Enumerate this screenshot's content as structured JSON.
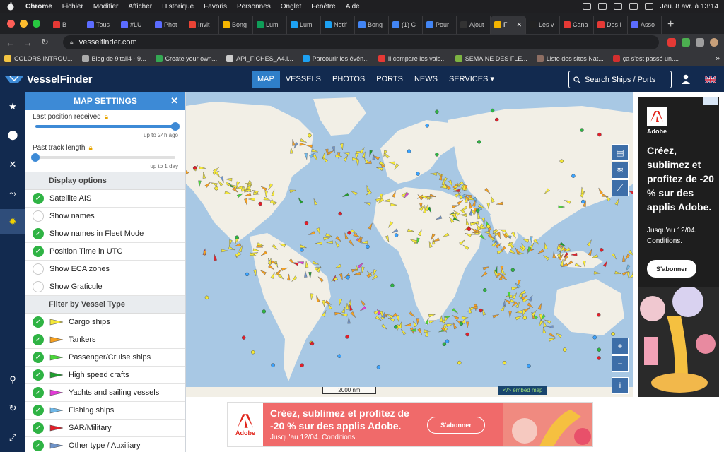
{
  "macos": {
    "app": "Chrome",
    "menus": [
      "Fichier",
      "Modifier",
      "Afficher",
      "Historique",
      "Favoris",
      "Personnes",
      "Onglet",
      "Fenêtre",
      "Aide"
    ],
    "datetime": "Jeu. 8 avr. à 13:14"
  },
  "tabs": [
    {
      "label": "B",
      "color": "#e53935"
    },
    {
      "label": "Tous",
      "color": "#5b6cff"
    },
    {
      "label": "#LU",
      "color": "#5b6cff"
    },
    {
      "label": "Phot",
      "color": "#5b6cff"
    },
    {
      "label": "Invit",
      "color": "#ea4335"
    },
    {
      "label": "Bong",
      "color": "#f4b400"
    },
    {
      "label": "Lumi",
      "color": "#0f9d58"
    },
    {
      "label": "Lumi",
      "color": "#1da1f2"
    },
    {
      "label": "Notif",
      "color": "#1da1f2"
    },
    {
      "label": "Bong",
      "color": "#4285f4"
    },
    {
      "label": "(1) C",
      "color": "#4285f4"
    },
    {
      "label": "Pour",
      "color": "#4285f4"
    },
    {
      "label": "Ajout",
      "color": "#333333"
    },
    {
      "label": "Fi",
      "color": "#f4b400",
      "active": true
    },
    {
      "label": "Les v",
      "color": "#222222"
    },
    {
      "label": "Cana",
      "color": "#e53935"
    },
    {
      "label": "Des I",
      "color": "#e53935"
    },
    {
      "label": "Asso",
      "color": "#5b6cff"
    }
  ],
  "address": {
    "url": "vesselfinder.com"
  },
  "bookmarks": [
    {
      "label": "COLORS INTROU...",
      "color": "#f4c542"
    },
    {
      "label": "Blog de 9itali4 - 9...",
      "color": "#aaaaaa"
    },
    {
      "label": "Create your own...",
      "color": "#34a853"
    },
    {
      "label": "API_FICHES_A4.i...",
      "color": "#cccccc"
    },
    {
      "label": "Parcourir les évén...",
      "color": "#1da1f2"
    },
    {
      "label": "Il compare les vais...",
      "color": "#e53935"
    },
    {
      "label": "SEMAINE DES FLE...",
      "color": "#7cb342"
    },
    {
      "label": "Liste des sites Nat...",
      "color": "#8d6e63"
    },
    {
      "label": "ça s'est passé un....",
      "color": "#d32f2f"
    }
  ],
  "site": {
    "brand": "VesselFinder",
    "nav": [
      {
        "label": "MAP",
        "active": true
      },
      {
        "label": "VESSELS"
      },
      {
        "label": "PHOTOS"
      },
      {
        "label": "PORTS"
      },
      {
        "label": "NEWS"
      },
      {
        "label": "SERVICES ▾"
      }
    ],
    "search_placeholder": "Search Ships  /  Ports"
  },
  "rail": [
    "star-icon",
    "pin-icon",
    "satellite-icon",
    "route-icon",
    "gear-icon",
    "antenna-icon",
    "refresh-icon",
    "expand-icon"
  ],
  "settings": {
    "title": "MAP SETTINGS",
    "last_position": {
      "label": "Last position received",
      "hint": "up to 24h ago",
      "value": 1.0
    },
    "past_track": {
      "label": "Past track length",
      "hint": "up to 1 day",
      "value": 0.0
    },
    "display_header": "Display options",
    "display_options": [
      {
        "label": "Satellite AIS",
        "on": true
      },
      {
        "label": "Show names",
        "on": false
      },
      {
        "label": "Show names in Fleet Mode",
        "on": true
      },
      {
        "label": "Position Time in UTC",
        "on": true
      },
      {
        "label": "Show ECA zones",
        "on": false
      },
      {
        "label": "Show Graticule",
        "on": false
      }
    ],
    "filter_header": "Filter by Vessel Type",
    "vessel_types": [
      {
        "label": "Cargo ships",
        "on": true,
        "color": "#f5e838"
      },
      {
        "label": "Tankers",
        "on": true,
        "color": "#f5a020"
      },
      {
        "label": "Passenger/Cruise ships",
        "on": true,
        "color": "#4bd63a"
      },
      {
        "label": "High speed crafts",
        "on": true,
        "color": "#1f9e2e"
      },
      {
        "label": "Yachts and sailing vessels",
        "on": true,
        "color": "#e23bd6"
      },
      {
        "label": "Fishing ships",
        "on": true,
        "color": "#6fb8e8"
      },
      {
        "label": "SAR/Military",
        "on": true,
        "color": "#e21f2a"
      },
      {
        "label": "Other type / Auxiliary",
        "on": true,
        "color": "#6f93c8"
      }
    ]
  },
  "map": {
    "scale_label": "2000 nm",
    "embed_label": "</> embed map",
    "zoom_in": "+",
    "zoom_out": "−",
    "info": "i",
    "colors": {
      "sea": "#a8c8e4",
      "land": "#f2efe6"
    }
  },
  "ad_right": {
    "brand": "Adobe",
    "headline": "Créez, sublimez et profitez de -20 % sur des applis Adobe.",
    "small": "Jusqu'au 12/04. Conditions.",
    "cta": "S'abonner"
  },
  "ad_bottom": {
    "brand": "Adobe",
    "headline_line1": "Créez, sublimez et profitez de",
    "headline_line2": "-20 % sur des applis Adobe.",
    "small": "Jusqu'au 12/04. Conditions.",
    "cta": "S'abonner"
  }
}
